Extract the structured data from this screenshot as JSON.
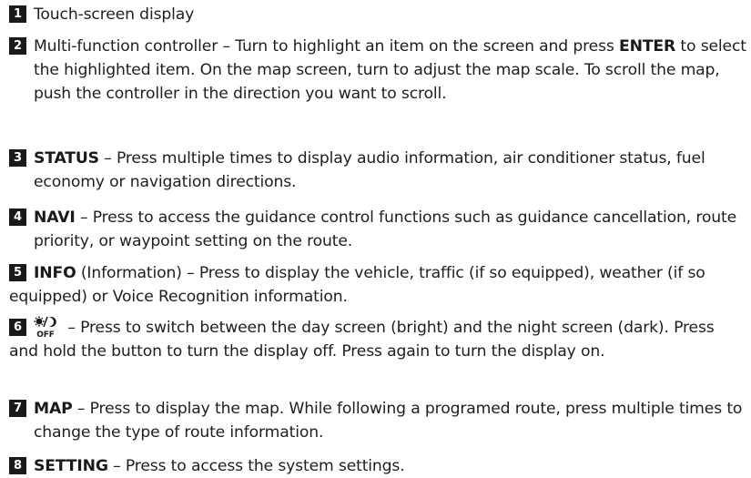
{
  "items": [
    {
      "num": "1",
      "text": "Touch-screen display"
    },
    {
      "num": "2",
      "before": "Multi-function controller – Turn to highlight an item on the screen and press ",
      "key": "ENTER",
      "after": " to select the highlighted item. On the map screen, turn to adjust the map scale. To scroll the map, push the controller in the direction you want to scroll."
    },
    {
      "num": "3",
      "key": "STATUS",
      "after": " – Press multiple times to display audio information, air conditioner status, fuel economy or navigation directions."
    },
    {
      "num": "4",
      "key": "NAVI",
      "after": " – Press to access the guidance control functions such as guidance cancellation, route priority, or waypoint setting on the route."
    },
    {
      "num": "5",
      "key": "INFO",
      "after": " (Information) – Press to display the vehicle, traffic (if so equipped), weather (if so equipped) or Voice Recognition information."
    },
    {
      "num": "6",
      "icon_label": "OFF",
      "icon": "day-night-off-icon",
      "after": " – Press to switch between the day screen (bright) and the night screen (dark). Press and hold the button to turn the display off. Press again to turn the display on."
    },
    {
      "num": "7",
      "key": "MAP",
      "after": " – Press to display the map. While following a programed route, press multiple times to change the type of route information."
    },
    {
      "num": "8",
      "key": "SETTING",
      "after": " – Press to access the system settings."
    }
  ]
}
